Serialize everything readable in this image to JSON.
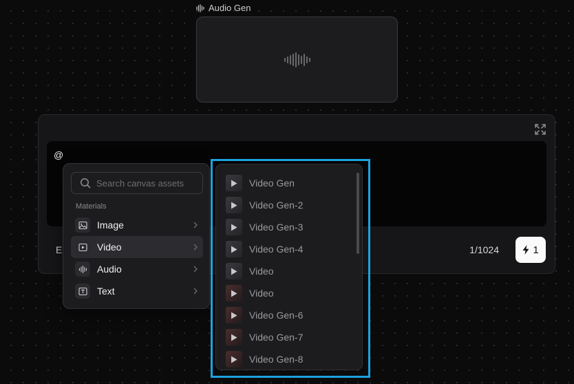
{
  "audio_node": {
    "label": "Audio Gen"
  },
  "prompt": {
    "text": "@",
    "partial_label": "El",
    "char_count": "1/1024",
    "run_button_count": "1"
  },
  "mention_menu": {
    "search_placeholder": "Search canvas assets",
    "section_label": "Materials",
    "items": [
      {
        "label": "Image",
        "icon": "image-icon"
      },
      {
        "label": "Video",
        "icon": "video-icon",
        "active": true
      },
      {
        "label": "Audio",
        "icon": "audio-wave-icon"
      },
      {
        "label": "Text",
        "icon": "text-icon"
      }
    ]
  },
  "video_submenu": {
    "items": [
      {
        "label": "Video Gen"
      },
      {
        "label": "Video Gen-2"
      },
      {
        "label": "Video Gen-3"
      },
      {
        "label": "Video Gen-4"
      },
      {
        "label": "Video"
      },
      {
        "label": "Video"
      },
      {
        "label": "Video Gen-6"
      },
      {
        "label": "Video Gen-7"
      },
      {
        "label": "Video Gen-8"
      }
    ]
  },
  "colors": {
    "highlight": "#1ca3e0",
    "background": "#0b0b0c",
    "panel": "#1c1c1e"
  }
}
